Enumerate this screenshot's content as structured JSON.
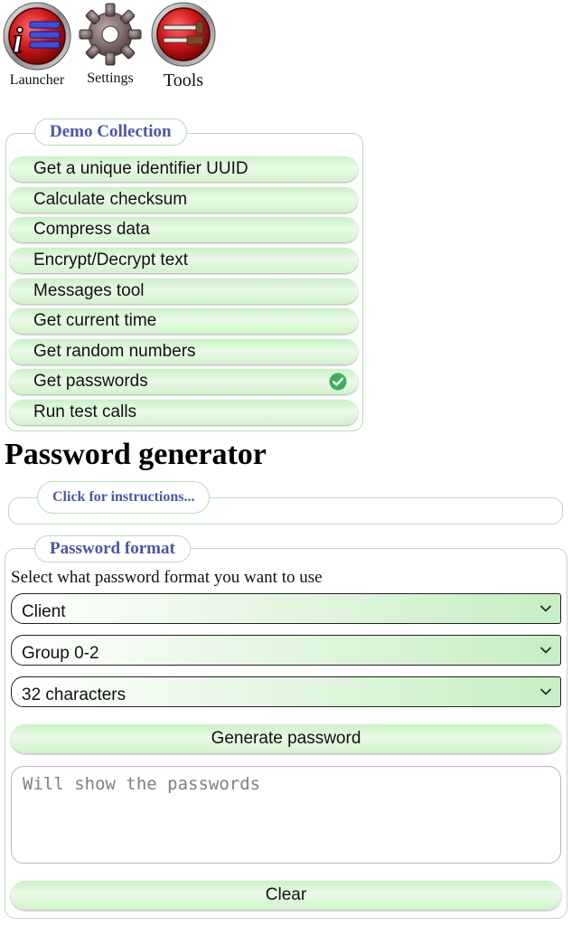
{
  "toolbar": {
    "items": [
      {
        "label": "Launcher",
        "icon": "launcher-icon"
      },
      {
        "label": "Settings",
        "icon": "gear-icon"
      },
      {
        "label": "Tools",
        "icon": "tools-icon"
      }
    ]
  },
  "demo_collection": {
    "legend": "Demo Collection",
    "items": [
      {
        "label": "Get a unique identifier UUID",
        "selected": false
      },
      {
        "label": "Calculate checksum",
        "selected": false
      },
      {
        "label": "Compress data",
        "selected": false
      },
      {
        "label": "Encrypt/Decrypt text",
        "selected": false
      },
      {
        "label": "Messages tool",
        "selected": false
      },
      {
        "label": "Get current time",
        "selected": false
      },
      {
        "label": "Get random numbers",
        "selected": false
      },
      {
        "label": "Get passwords",
        "selected": true,
        "badge_icon": "check-circle-icon"
      },
      {
        "label": "Run test calls",
        "selected": false
      }
    ]
  },
  "page": {
    "title": "Password generator"
  },
  "instructions": {
    "legend": "Click for instructions..."
  },
  "password_format": {
    "legend": "Password format",
    "description": "Select what password format you want to use",
    "selects": {
      "format": "Client",
      "group": "Group 0-2",
      "length": "32 characters"
    },
    "generate_label": "Generate password",
    "output_placeholder": "Will show the passwords",
    "output_value": "",
    "clear_label": "Clear"
  },
  "colors": {
    "legend_text": "#4b55a8",
    "button_green": "#d2f3cc",
    "box_border": "#b9dcb9",
    "check_green": "#3fae5a"
  }
}
